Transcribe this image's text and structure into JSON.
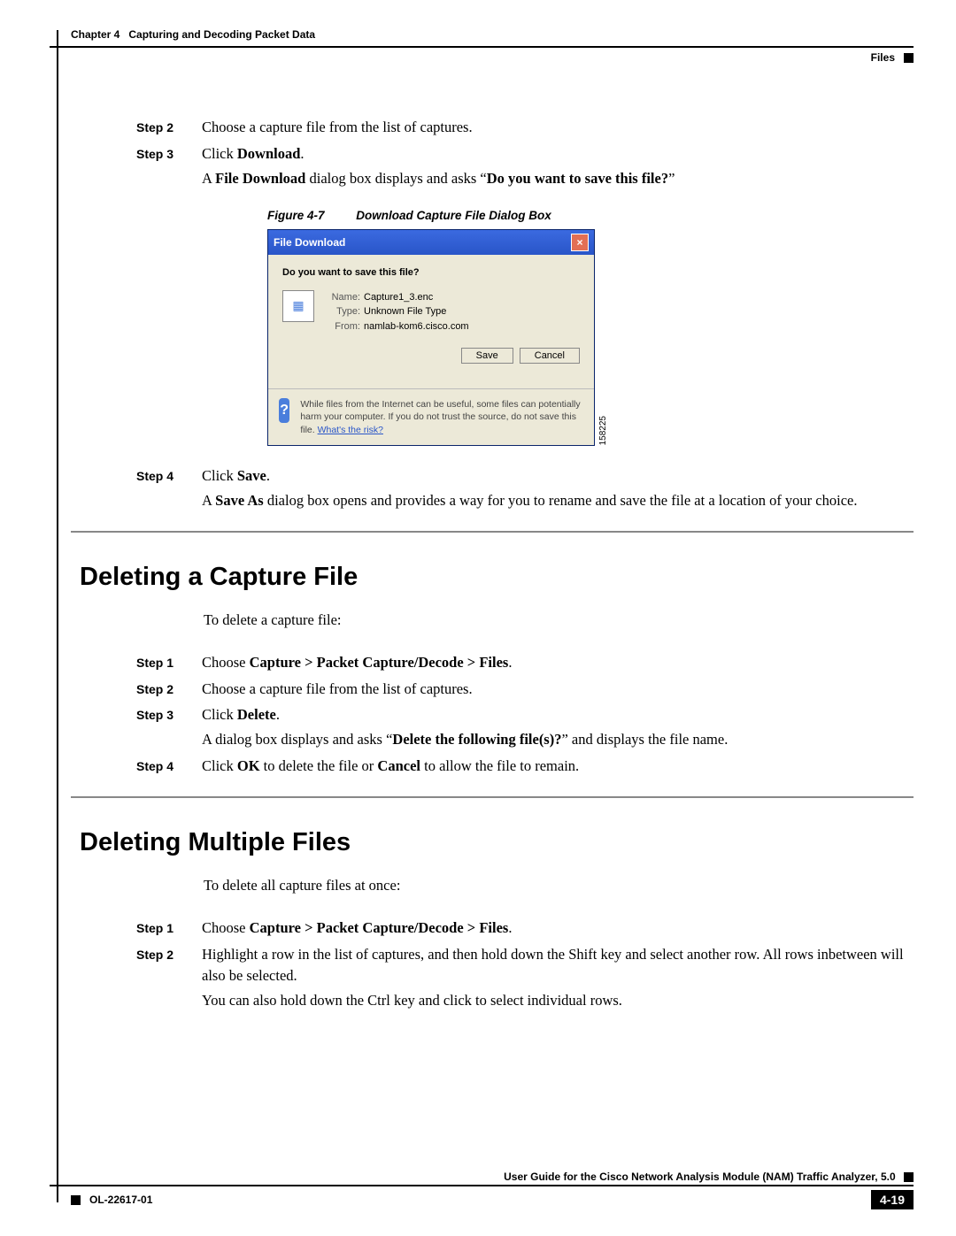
{
  "header": {
    "chapter": "Chapter 4",
    "title": "Capturing and Decoding Packet Data",
    "section": "Files"
  },
  "section1": {
    "step2": {
      "label": "Step 2",
      "text": "Choose a capture file from the list of captures."
    },
    "step3": {
      "label": "Step 3",
      "pre": "Click ",
      "bold": "Download",
      "post": ".",
      "cont_pre": "A ",
      "cont_b1": "File Download",
      "cont_mid": " dialog box displays and asks “",
      "cont_b2": "Do you want to save this file?",
      "cont_suf": "”"
    },
    "figure": {
      "num": "Figure 4-7",
      "title": "Download Capture File Dialog Box"
    },
    "dialog": {
      "title": "File Download",
      "question": "Do you want to save this file?",
      "name_k": "Name:",
      "name_v": "Capture1_3.enc",
      "type_k": "Type:",
      "type_v": "Unknown File Type",
      "from_k": "From:",
      "from_v": "namlab-kom6.cisco.com",
      "save": "Save",
      "cancel": "Cancel",
      "warn": "While files from the Internet can be useful, some files can potentially harm your computer. If you do not trust the source, do not save this file. ",
      "risk": "What's the risk?",
      "imgnum": "158225"
    },
    "step4": {
      "label": "Step 4",
      "pre": "Click ",
      "bold": "Save",
      "post": ".",
      "cont_pre": "A ",
      "cont_b1": "Save As",
      "cont_post": " dialog box opens and provides a way for you to rename and save the file at a location of your choice."
    }
  },
  "section2": {
    "heading": "Deleting a Capture File",
    "intro": "To delete a capture file:",
    "step1": {
      "label": "Step 1",
      "pre": "Choose ",
      "bold": "Capture > Packet Capture/Decode > Files",
      "post": "."
    },
    "step2": {
      "label": "Step 2",
      "text": "Choose a capture file from the list of captures."
    },
    "step3": {
      "label": "Step 3",
      "pre": "Click ",
      "bold": "Delete",
      "post": ".",
      "cont_pre": "A dialog box displays and asks “",
      "cont_b1": "Delete the following file(s)?",
      "cont_post": "” and displays the file name."
    },
    "step4": {
      "label": "Step 4",
      "p1": "Click ",
      "b1": "OK",
      "p2": " to delete the file or ",
      "b2": "Cancel",
      "p3": " to allow the file to remain."
    }
  },
  "section3": {
    "heading": "Deleting Multiple Files",
    "intro": "To delete all capture files at once:",
    "step1": {
      "label": "Step 1",
      "pre": "Choose ",
      "bold": "Capture > Packet Capture/Decode > Files",
      "post": "."
    },
    "step2": {
      "label": "Step 2",
      "text": "Highlight a row in the list of captures, and then hold down the Shift key and select another row. All rows inbetween will also be selected.",
      "cont": "You can also hold down the Ctrl key and click to select individual rows."
    }
  },
  "footer": {
    "guide": "User Guide for the Cisco Network Analysis Module (NAM) Traffic Analyzer, 5.0",
    "docid": "OL-22617-01",
    "pagenum": "4-19"
  }
}
